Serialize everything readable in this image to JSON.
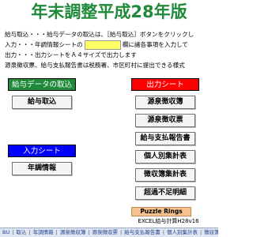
{
  "title": "年末調整平成28年版",
  "instructions": {
    "line1": "給与取込・・・給与データの取込は、［給与取込］ボタンをクリックし",
    "line2_a": "入力・・・年調情報シートの",
    "line2_b": "欄に諸各事項を入力して",
    "line3": "出力・・・出力シートをＡ４サイズで出力します",
    "line4": "源泉徴収票、給与支払報告書は税務署、市区町村に提出できる様式"
  },
  "left": {
    "kyuyo_header": "給与データの取込",
    "kyuyo_button": "給与取込",
    "input_header": "入力シート",
    "nencho_button": "年調情報"
  },
  "right": {
    "output_header": "出力シート",
    "buttons": [
      "源泉徴収簿",
      "源泉徴収票",
      "給与支払報告書",
      "個人別集計表",
      "徴収簿集計表",
      "超過不足明細"
    ]
  },
  "puzzle_label": "Puzzle Rings",
  "version": "EXCEL給与計算H28v16",
  "tabs": [
    "取込",
    "年調情報",
    "源泉徴収簿",
    "源泉徴収票",
    "給与支払報告書",
    "個人別集計表",
    "徴収簿"
  ],
  "tab_first_partial": "BU",
  "colors": {
    "title": "#1e8a3a",
    "kyuyo_header": "#1f8a3a",
    "output_header": "#ff0000",
    "input_header": "#0000ff",
    "highlight": "#ffff66"
  }
}
